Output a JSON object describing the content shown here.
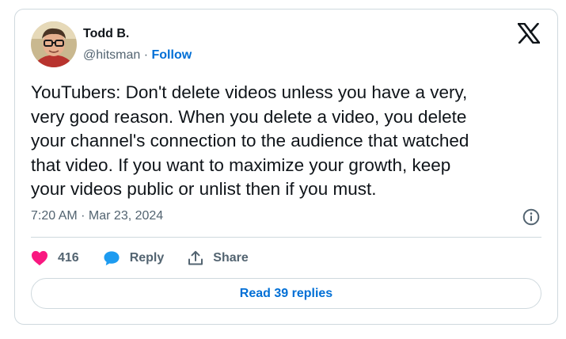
{
  "author": {
    "name": "Todd B.",
    "handle": "@hitsman",
    "separator": "·",
    "follow_label": "Follow"
  },
  "tweet": {
    "text": "YouTubers: Don't delete videos unless you have a very,\nvery good reason. When you delete a video, you delete\nyour channel's connection to the audience that watched\nthat video. If you want to maximize your growth, keep\nyour videos public or unlist then if you must.",
    "timestamp": "7:20 AM · Mar 23, 2024"
  },
  "actions": {
    "like_count": "416",
    "reply_label": "Reply",
    "share_label": "Share"
  },
  "read_replies_label": "Read 39 replies",
  "icons": {
    "logo": "x-logo-icon",
    "info": "info-icon",
    "like": "heart-icon",
    "reply": "speech-bubble-icon",
    "share": "share-upload-icon"
  },
  "colors": {
    "heart": "#f91880",
    "reply_bubble": "#1d9bf0",
    "link": "#006fd6",
    "muted": "#536471",
    "border": "#cfd9de"
  }
}
